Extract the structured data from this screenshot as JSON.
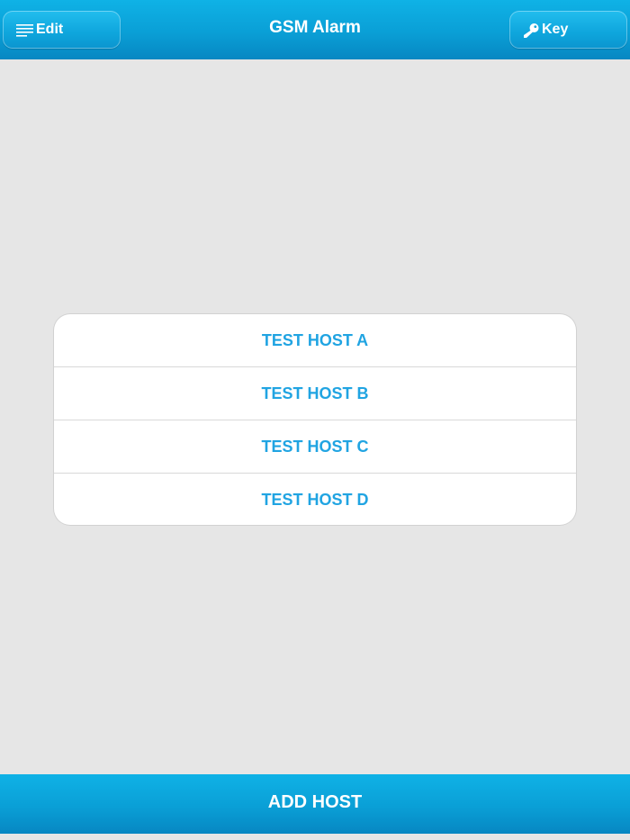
{
  "navbar": {
    "title": "GSM Alarm",
    "edit_label": "Edit",
    "key_label": "Key",
    "edit_icon": "menu-icon",
    "key_icon": "key-icon"
  },
  "hosts": [
    {
      "label": "TEST HOST A"
    },
    {
      "label": "TEST HOST B"
    },
    {
      "label": "TEST HOST C"
    },
    {
      "label": "TEST HOST D"
    }
  ],
  "footer": {
    "add_host_label": "ADD HOST"
  },
  "colors": {
    "accent": "#0a9fd6",
    "host_text": "#20a4e2",
    "background": "#e6e6e6"
  }
}
